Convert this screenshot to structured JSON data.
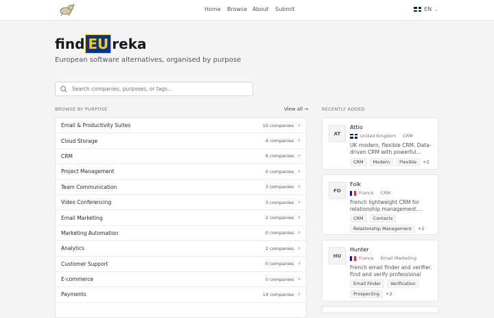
{
  "header": {
    "nav": [
      "Home",
      "Browse",
      "About",
      "Submit"
    ],
    "language": "EN"
  },
  "hero": {
    "brand_prefix": "find",
    "brand_highlight": "EU",
    "brand_suffix": "reka",
    "subtitle": "European software alternatives, organised by purpose"
  },
  "search": {
    "placeholder": "Search companies, purposes, or tags..."
  },
  "browse": {
    "label": "BROWSE BY PURPOSE",
    "view_all": "View all →",
    "items": [
      {
        "name": "Email & Productivity Suites",
        "count": "10 companies"
      },
      {
        "name": "Cloud Storage",
        "count": "4 companies"
      },
      {
        "name": "CRM",
        "count": "6 companies"
      },
      {
        "name": "Project Management",
        "count": "0 companies"
      },
      {
        "name": "Team Communication",
        "count": "3 companies"
      },
      {
        "name": "Video Conferencing",
        "count": "3 companies"
      },
      {
        "name": "Email Marketing",
        "count": "2 companies"
      },
      {
        "name": "Marketing Automation",
        "count": "0 companies"
      },
      {
        "name": "Analytics",
        "count": "2 companies"
      },
      {
        "name": "Customer Support",
        "count": "0 companies"
      },
      {
        "name": "E-commerce",
        "count": "0 companies"
      },
      {
        "name": "Payments",
        "count": "14 companies"
      }
    ]
  },
  "recent": {
    "label": "RECENTLY ADDED",
    "cards": [
      {
        "initials": "AT",
        "name": "Attio",
        "flag": "uk-flag-icon",
        "country": "United Kingdom",
        "category": "CRM",
        "desc": [
          "UK modern, flexible CRM. Data-",
          "driven CRM with powerful..."
        ],
        "tags": [
          "CRM",
          "Modern",
          "Flexible"
        ],
        "more": "+2"
      },
      {
        "initials": "FO",
        "name": "Folk",
        "flag": "fr-flag-icon",
        "country": "France",
        "category": "CRM",
        "desc": [
          "French lightweight CRM for",
          "relationship management...."
        ],
        "tags": [
          "CRM",
          "Contacts",
          "Relationship Management"
        ],
        "more": "+2"
      },
      {
        "initials": "HU",
        "name": "Hunter",
        "flag": "fr-flag-icon",
        "country": "France",
        "category": "Email Marketing",
        "desc": [
          "French email finder and verifier.",
          "Find and verify professional ema..."
        ],
        "tags": [
          "Email Finder",
          "Verification",
          "Prospecting"
        ],
        "more": "+2"
      }
    ]
  }
}
